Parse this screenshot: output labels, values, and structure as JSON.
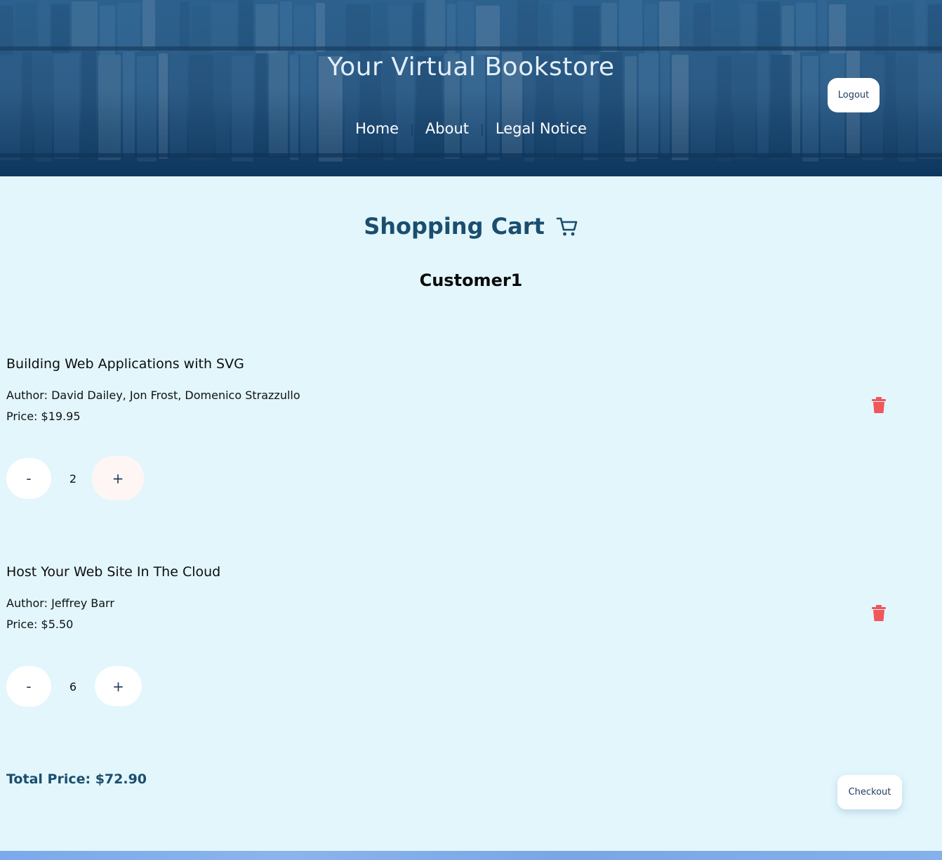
{
  "header": {
    "title": "Your Virtual Bookstore",
    "nav": [
      {
        "label": "Home"
      },
      {
        "label": "About"
      },
      {
        "label": "Legal Notice"
      }
    ],
    "nav_separator": "|",
    "logout_label": "Logout"
  },
  "cart": {
    "title": "Shopping Cart",
    "icon": "cart-icon",
    "customer": "Customer1",
    "items": [
      {
        "title": "Building Web Applications with SVG",
        "author": "Author: David Dailey, Jon Frost, Domenico Strazzullo",
        "price": "Price: $19.95",
        "quantity": "2",
        "minus_label": "-",
        "plus_label": "+",
        "delete_icon": "trash-icon"
      },
      {
        "title": "Host Your Web Site In The Cloud",
        "author": "Author: Jeffrey Barr",
        "price": "Price: $5.50",
        "quantity": "6",
        "minus_label": "-",
        "plus_label": "+",
        "delete_icon": "trash-icon"
      }
    ],
    "total": "Total Price: $72.90",
    "checkout_label": "Checkout"
  },
  "colors": {
    "page_background": "#e2f6fc",
    "accent": "#1b4e6e",
    "delete": "#f0565a",
    "button": "#ffffff"
  }
}
